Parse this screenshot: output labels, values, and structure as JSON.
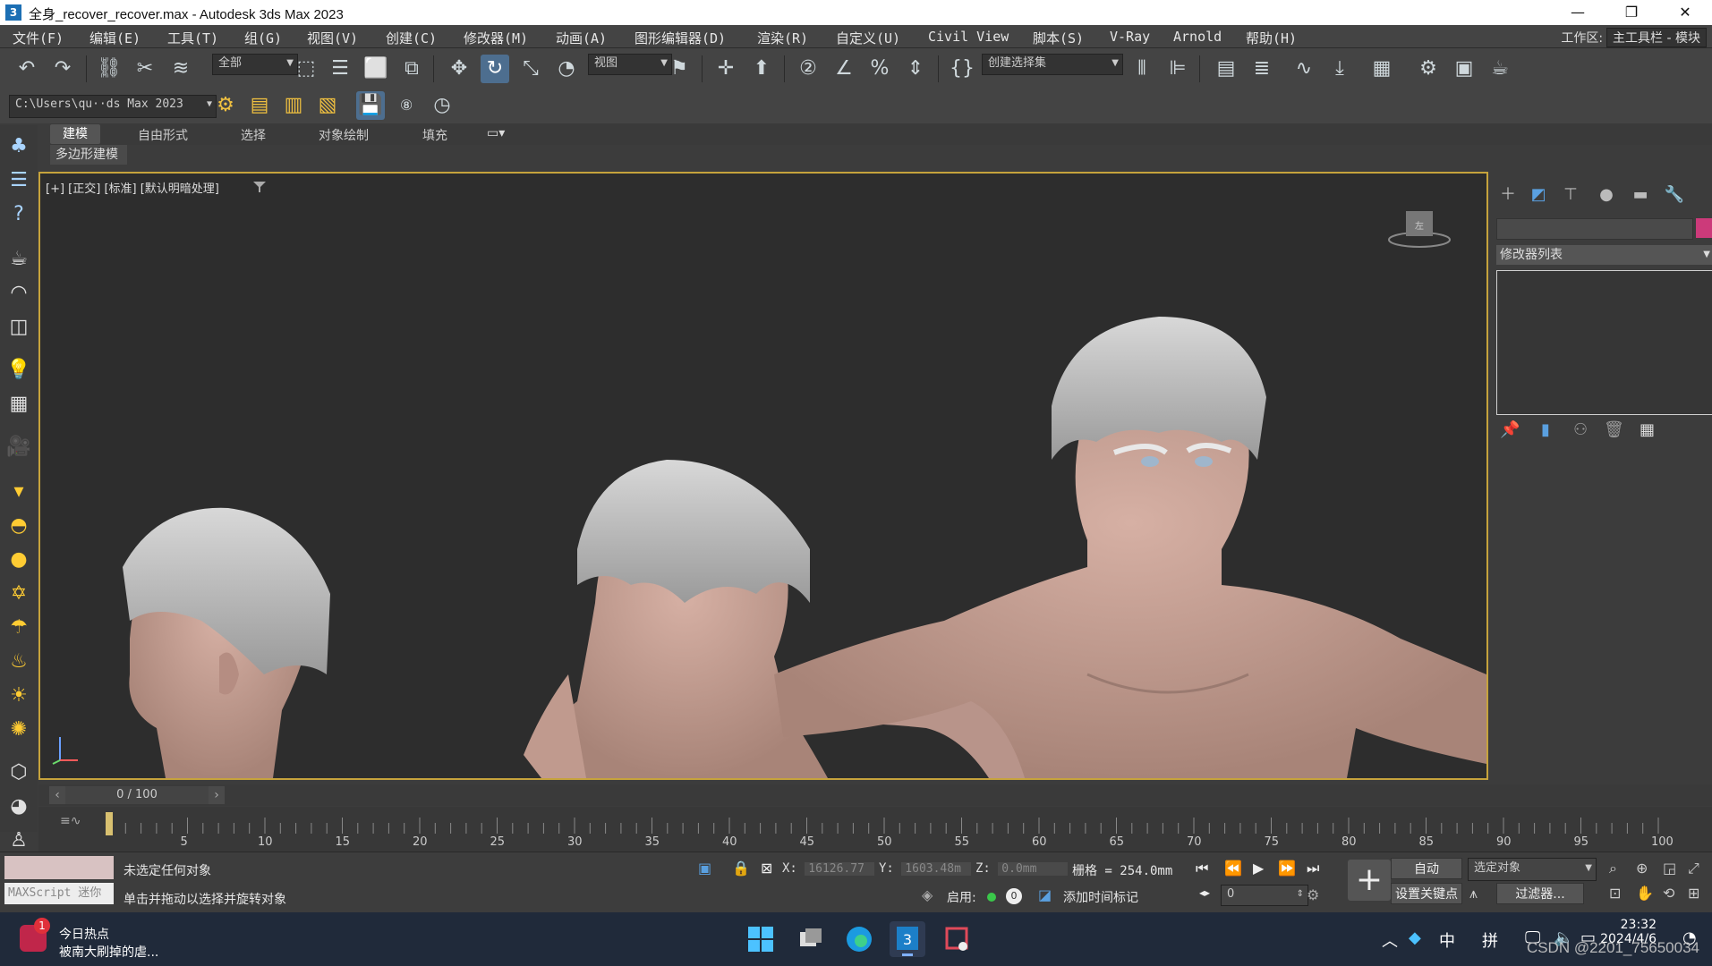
{
  "window": {
    "title": "全身_recover_recover.max - Autodesk 3ds Max 2023",
    "app_icon": "3",
    "minimize": "—",
    "restore": "❐",
    "close": "✕"
  },
  "menu": {
    "items": [
      "文件(F)",
      "编辑(E)",
      "工具(T)",
      "组(G)",
      "视图(V)",
      "创建(C)",
      "修改器(M)",
      "动画(A)",
      "图形编辑器(D)",
      "渲染(R)",
      "自定义(U)",
      "Civil View",
      "脚本(S)",
      "V-Ray",
      "Arnold",
      "帮助(H)"
    ],
    "workspace_label": "工作区:",
    "workspace_value": "主工具栏 - 模块"
  },
  "toolbar": {
    "selection_filter": "全部",
    "ref_coord": "视图",
    "named_selection": "创建选择集",
    "path": "C:\\Users\\qu··ds Max 2023"
  },
  "ribbon": {
    "tabs": [
      "建模",
      "自由形式",
      "选择",
      "对象绘制",
      "填充"
    ],
    "active_tab": "建模",
    "sub": "多边形建模"
  },
  "viewport": {
    "label": "[+] [正交] [标准] [默认明暗处理]",
    "viewcube_text": "左"
  },
  "command_panel": {
    "modifier_list": "修改器列表",
    "object_color": "#cc3a7a"
  },
  "timeline": {
    "frame": "0 / 100",
    "ticks": [
      "5",
      "10",
      "15",
      "20",
      "25",
      "30",
      "35",
      "40",
      "45",
      "50",
      "55",
      "60",
      "65",
      "70",
      "75",
      "80",
      "85",
      "90",
      "95",
      "100"
    ]
  },
  "status": {
    "maxscript": "MAXScript 迷你",
    "line1": "未选定任何对象",
    "line2": "单击并拖动以选择并旋转对象",
    "x_label": "X:",
    "x_value": "16126.77",
    "y_label": "Y:",
    "y_value": "1603.48m",
    "z_label": "Z:",
    "z_value": "0.0mm",
    "grid": "栅格 = 254.0mm",
    "enable": "启用:",
    "add_time_tag": "添加时间标记",
    "frame_value": "0",
    "auto": "自动",
    "selected_object": "选定对象",
    "set_key": "设置关键点",
    "filters": "过滤器..."
  },
  "taskbar": {
    "news_badge": "1",
    "news_title": "今日热点",
    "news_sub": "被南大刷掉的虐...",
    "tray_input": "中",
    "tray_ime": "拼",
    "time": "23:32",
    "date": "2024/4/6",
    "watermark": "CSDN @2201_75650034"
  }
}
